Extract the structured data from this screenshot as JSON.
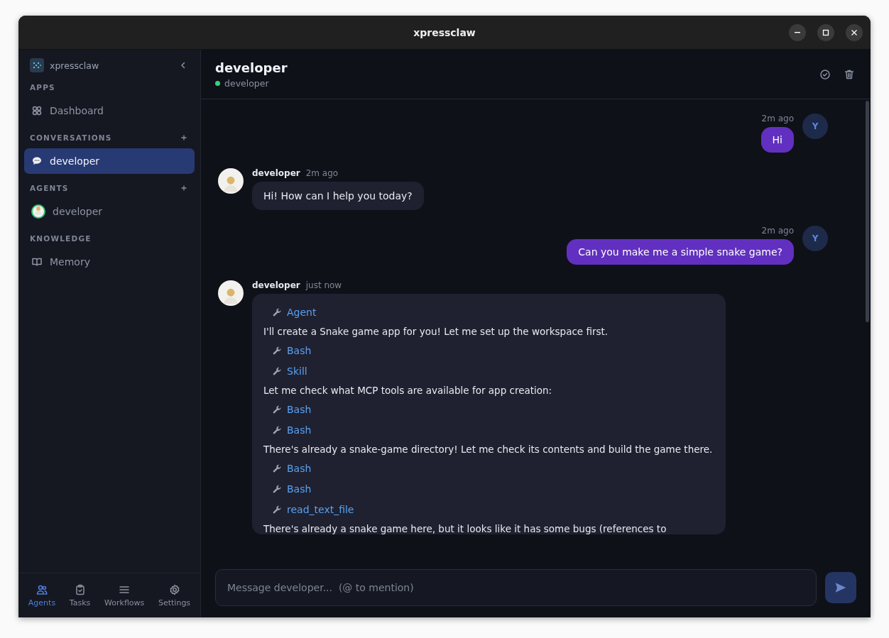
{
  "window": {
    "title": "xpressclaw"
  },
  "sidebar": {
    "brand": "xpressclaw",
    "sections": [
      {
        "title": "APPS",
        "addable": false,
        "items": [
          {
            "kind": "dashboard",
            "label": "Dashboard",
            "selected": false
          }
        ]
      },
      {
        "title": "CONVERSATIONS",
        "addable": true,
        "items": [
          {
            "kind": "chat",
            "label": "developer",
            "selected": true
          }
        ]
      },
      {
        "title": "AGENTS",
        "addable": true,
        "items": [
          {
            "kind": "agent",
            "label": "developer",
            "selected": false
          }
        ]
      },
      {
        "title": "KNOWLEDGE",
        "addable": false,
        "items": [
          {
            "kind": "memory",
            "label": "Memory",
            "selected": false
          }
        ]
      }
    ],
    "nav": [
      {
        "kind": "agents",
        "label": "Agents",
        "selected": true
      },
      {
        "kind": "tasks",
        "label": "Tasks",
        "selected": false
      },
      {
        "kind": "workflows",
        "label": "Workflows",
        "selected": false
      },
      {
        "kind": "settings",
        "label": "Settings",
        "selected": false
      }
    ]
  },
  "header": {
    "title": "developer",
    "status": "developer",
    "online": true
  },
  "messages": [
    {
      "kind": "user",
      "time": "2m ago",
      "avatar": "Y",
      "text": "Hi"
    },
    {
      "kind": "agent",
      "name": "developer",
      "time": "2m ago",
      "text": "Hi! How can I help you today?"
    },
    {
      "kind": "user",
      "time": "2m ago",
      "avatar": "Y",
      "text": "Can you make me a simple snake game?"
    },
    {
      "kind": "agent",
      "name": "developer",
      "time": "just now",
      "parts": [
        {
          "kind": "tool",
          "text": "Agent"
        },
        {
          "kind": "text",
          "text": "I'll create a Snake game app for you! Let me set up the workspace first."
        },
        {
          "kind": "tool",
          "text": "Bash"
        },
        {
          "kind": "tool",
          "text": "Skill"
        },
        {
          "kind": "text",
          "text": "Let me check what MCP tools are available for app creation:"
        },
        {
          "kind": "tool",
          "text": "Bash"
        },
        {
          "kind": "tool",
          "text": "Bash"
        },
        {
          "kind": "text",
          "text": "There's already a snake-game directory! Let me check its contents and build the game there."
        },
        {
          "kind": "tool",
          "text": "Bash"
        },
        {
          "kind": "tool",
          "text": "Bash"
        },
        {
          "kind": "tool",
          "text": "read_text_file"
        },
        {
          "kind": "text",
          "text": "There's already a snake game here, but it looks like it has some bugs (references to"
        }
      ]
    }
  ],
  "composer": {
    "placeholder": "Message developer...  (@ to mention)"
  }
}
